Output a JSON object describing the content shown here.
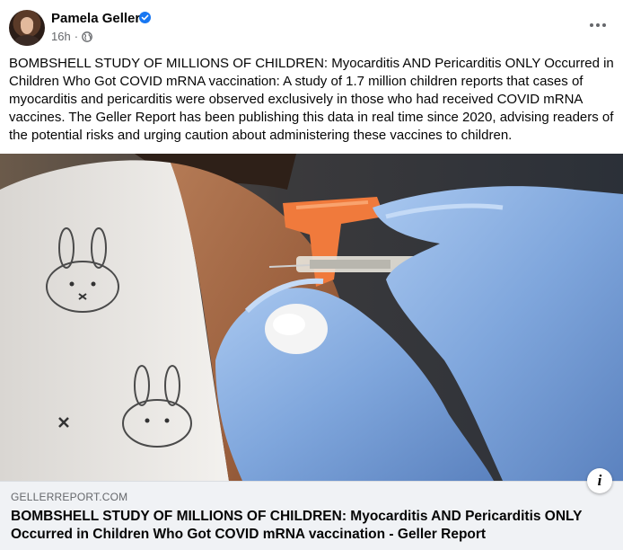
{
  "post": {
    "author": "Pamela Geller",
    "time": "16h",
    "separator": "·",
    "text": "BOMBSHELL STUDY OF MILLIONS OF CHILDREN: Myocarditis AND Pericarditis ONLY Occurred in Children Who Got COVID mRNA vaccination: A study of 1.7 million children reports that cases of myocarditis and pericarditis were observed exclusively in those who had received COVID mRNA vaccines. The Geller Report has been publishing this data in real time since 2020, advising readers of the potential risks and urging caution about administering these vaccines to children."
  },
  "link_preview": {
    "domain": "GELLERREPORT.COM",
    "title": "BOMBSHELL STUDY OF MILLIONS OF CHILDREN: Myocarditis AND Pericarditis ONLY Occurred in Children Who Got COVID mRNA vaccination - Geller Report",
    "info_glyph": "i"
  },
  "icons": {
    "verified": "verified-badge-icon",
    "audience": "globe-icon",
    "more": "more-options-icon",
    "info": "info-icon"
  },
  "colors": {
    "verified_blue": "#1877f2",
    "secondary_text": "#65676b",
    "preview_bg": "#f0f2f5"
  }
}
